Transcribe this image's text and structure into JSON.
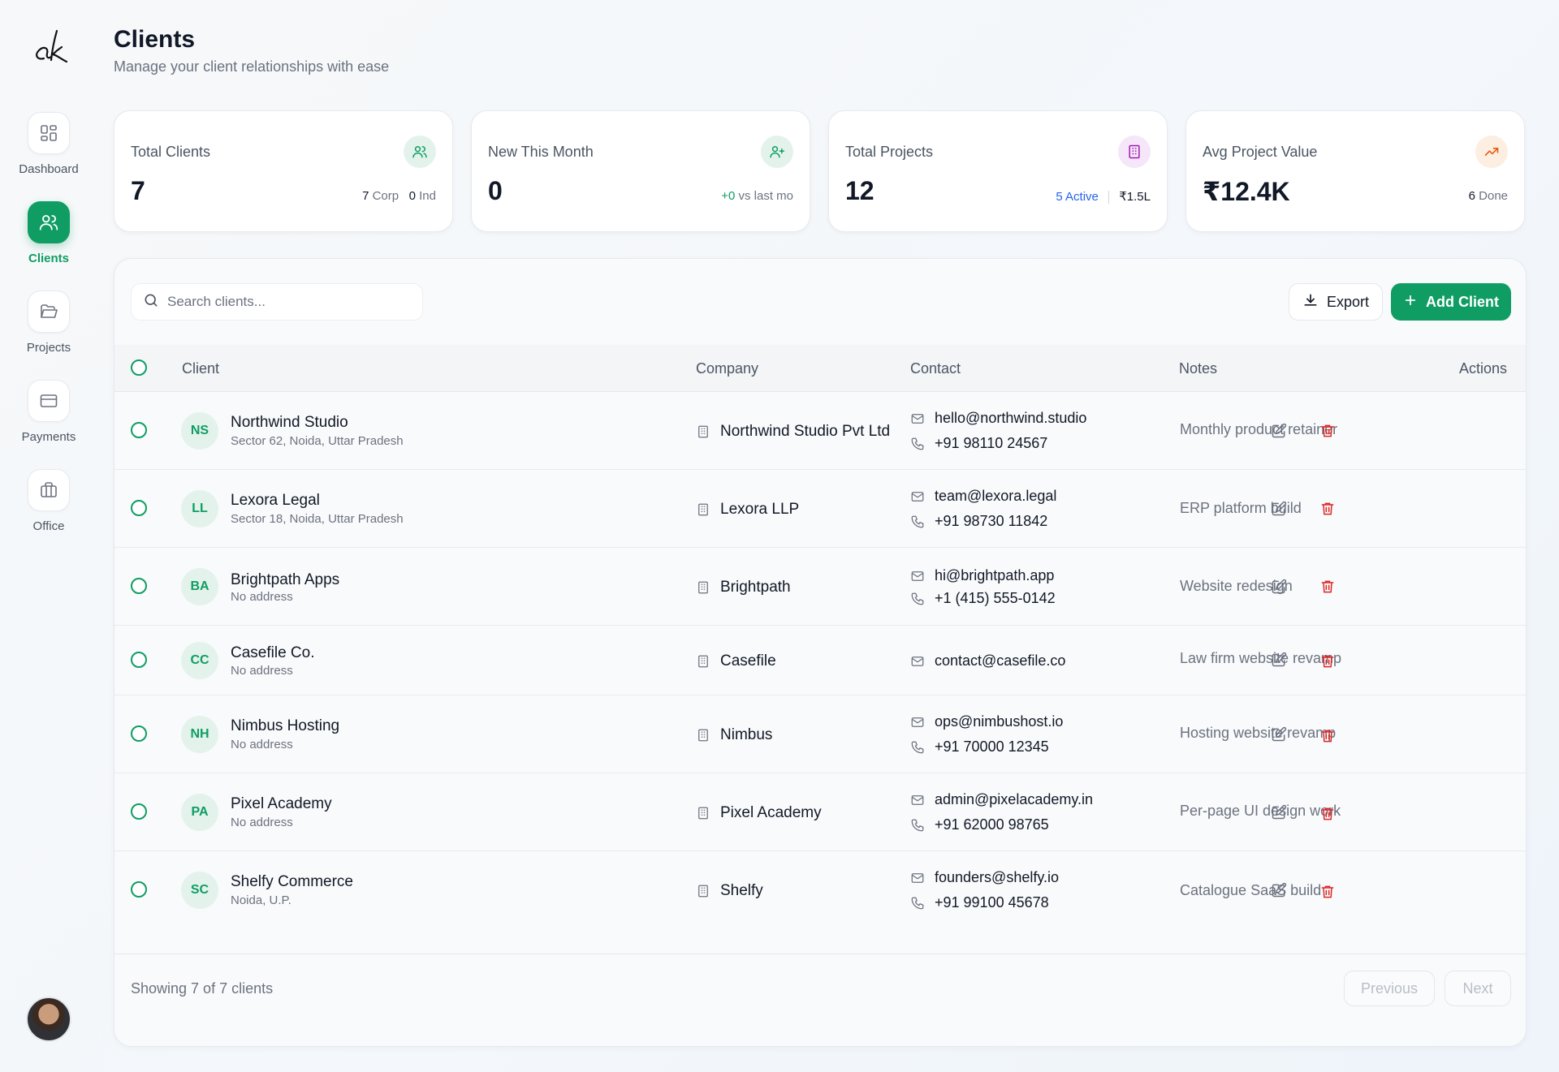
{
  "header": {
    "title": "Clients",
    "subtitle": "Manage your client relationships with ease"
  },
  "sidebar": {
    "logo_text": "ak",
    "items": [
      {
        "label": "Dashboard",
        "icon": "grid-icon"
      },
      {
        "label": "Clients",
        "icon": "users-icon",
        "active": true
      },
      {
        "label": "Projects",
        "icon": "folder-icon"
      },
      {
        "label": "Payments",
        "icon": "card-icon"
      },
      {
        "label": "Office",
        "icon": "briefcase-icon"
      }
    ]
  },
  "stats": [
    {
      "label": "Total Clients",
      "value": "7",
      "meta": {
        "a_num": "7",
        "a_text": "Corp",
        "b_num": "0",
        "b_text": "Ind"
      },
      "icon": "users-icon",
      "icon_color": "#0f9d63",
      "icon_bg": "#e3f3eb"
    },
    {
      "label": "New This Month",
      "value": "0",
      "meta": {
        "delta": "+0",
        "text": "vs last mo"
      },
      "icon": "user-plus-icon",
      "icon_color": "#0f9d63",
      "icon_bg": "#e3f3eb"
    },
    {
      "label": "Total Projects",
      "value": "12",
      "meta": {
        "active_num": "5",
        "active_text": "Active",
        "amount": "₹1.5L"
      },
      "icon": "building-icon",
      "icon_color": "#a21caf",
      "icon_bg": "#f5e6fa"
    },
    {
      "label": "Avg Project Value",
      "value": "₹12.4K",
      "meta": {
        "done_num": "6",
        "done_text": "Done"
      },
      "icon": "trend-up-icon",
      "icon_color": "#ea580c",
      "icon_bg": "#fdeee2"
    }
  ],
  "toolbar": {
    "search_placeholder": "Search clients...",
    "export_label": "Export",
    "add_label": "Add Client"
  },
  "table": {
    "columns": {
      "client": "Client",
      "company": "Company",
      "contact": "Contact",
      "notes": "Notes",
      "actions": "Actions"
    },
    "rows": [
      {
        "initials": "NS",
        "name": "Northwind Studio",
        "address": "Sector 62, Noida, Uttar Pradesh",
        "company": "Northwind Studio Pvt Ltd",
        "email": "hello@northwind.studio",
        "phone": "+91 98110 24567",
        "notes": "Monthly product retainer"
      },
      {
        "initials": "LL",
        "name": "Lexora Legal",
        "address": "Sector 18, Noida, Uttar Pradesh",
        "company": "Lexora LLP",
        "email": "team@lexora.legal",
        "phone": "+91 98730 11842",
        "notes": "ERP platform build"
      },
      {
        "initials": "BA",
        "name": "Brightpath Apps",
        "address": "No address",
        "company": "Brightpath",
        "email": "hi@brightpath.app",
        "phone": "+1 (415) 555-0142",
        "notes": "Website redesign"
      },
      {
        "initials": "CC",
        "name": "Casefile Co.",
        "address": "No address",
        "company": "Casefile",
        "email": "contact@casefile.co",
        "phone": "",
        "notes": "Law firm website revamp"
      },
      {
        "initials": "NH",
        "name": "Nimbus Hosting",
        "address": "No address",
        "company": "Nimbus",
        "email": "ops@nimbushost.io",
        "phone": "+91 70000 12345",
        "notes": "Hosting website revamp"
      },
      {
        "initials": "PA",
        "name": "Pixel Academy",
        "address": "No address",
        "company": "Pixel Academy",
        "email": "admin@pixelacademy.in",
        "phone": "+91 62000 98765",
        "notes": "Per-page UI design work"
      },
      {
        "initials": "SC",
        "name": "Shelfy Commerce",
        "address": "Noida, U.P.",
        "company": "Shelfy",
        "email": "founders@shelfy.io",
        "phone": "+91 99100 45678",
        "notes": "Catalogue SaaS build"
      }
    ]
  },
  "footer": {
    "showing": "Showing 7 of 7 clients",
    "previous": "Previous",
    "next": "Next"
  }
}
